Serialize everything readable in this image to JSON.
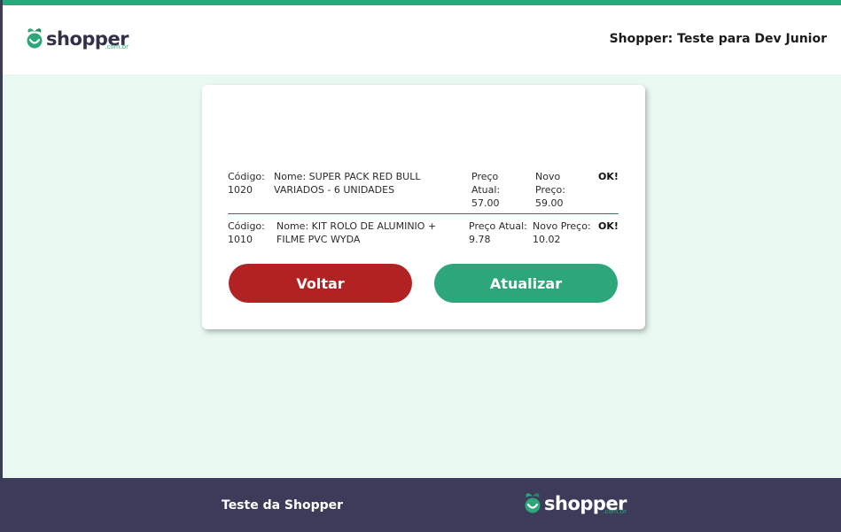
{
  "header": {
    "logo_text": "shopper",
    "logo_sub": ".com.br",
    "title": "Shopper: Teste para Dev Junior"
  },
  "products": [
    {
      "code_label": "Código:",
      "code": "1020",
      "name_label": "Nome:",
      "name": "SUPER PACK RED BULL VARIADOS - 6 UNIDADES",
      "price_label": "Preço Atual:",
      "price": "57.00",
      "new_price_label": "Novo Preço:",
      "new_price": "59.00",
      "status": "OK!"
    },
    {
      "code_label": "Código:",
      "code": "1010",
      "name_label": "Nome:",
      "name": "KIT ROLO DE ALUMINIO + FILME PVC WYDA",
      "price_label": "Preço Atual:",
      "price": "9.78",
      "new_price_label": "Novo Preço:",
      "new_price": "10.02",
      "status": "OK!"
    }
  ],
  "buttons": {
    "back": "Voltar",
    "update": "Atualizar"
  },
  "footer": {
    "text": "Teste da Shopper",
    "logo_text": "shopper",
    "logo_sub": ".com.br"
  },
  "colors": {
    "brand_green": "#2da77a",
    "back_red": "#b22222",
    "footer_navy": "#3c3c5a",
    "page_bg": "#e9f8f1"
  }
}
